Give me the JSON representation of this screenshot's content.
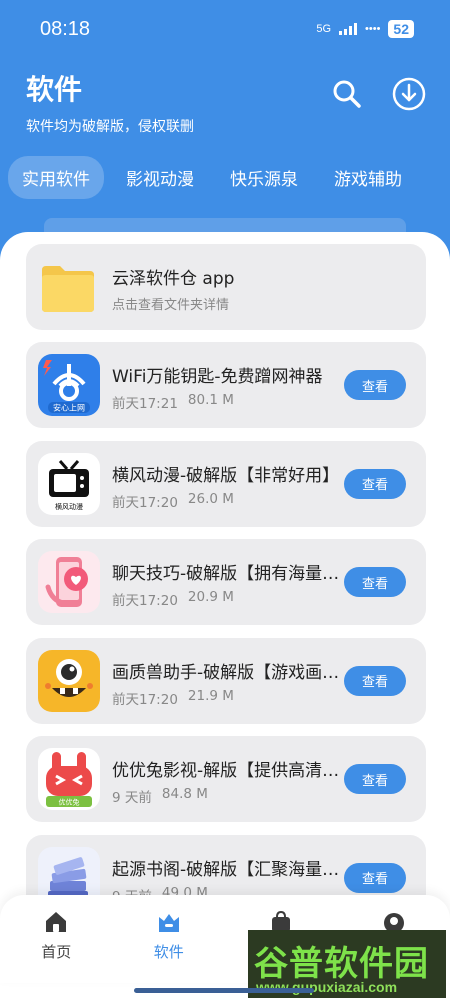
{
  "status": {
    "time": "08:18",
    "network": "5G",
    "battery": "52"
  },
  "header": {
    "title": "软件",
    "subtitle": "软件均为破解版，侵权联删"
  },
  "tabs": [
    {
      "label": "实用软件",
      "active": true
    },
    {
      "label": "影视动漫",
      "active": false
    },
    {
      "label": "快乐源泉",
      "active": false
    },
    {
      "label": "游戏辅助",
      "active": false
    }
  ],
  "folder": {
    "title": "云泽软件仓 app",
    "subtitle": "点击查看文件夹详情"
  },
  "apps": [
    {
      "title": "WiFi万能钥匙-免费蹭网神器",
      "time": "前天17:21",
      "size": "80.1 M",
      "button": "查看"
    },
    {
      "title": "横风动漫-破解版【非常好用】",
      "time": "前天17:20",
      "size": "26.0 M",
      "button": "查看"
    },
    {
      "title": "聊天技巧-破解版【拥有海量话术】",
      "time": "前天17:20",
      "size": "20.9 M",
      "button": "查看"
    },
    {
      "title": "画质兽助手-破解版【游戏画质】",
      "time": "前天17:20",
      "size": "21.9 M",
      "button": "查看"
    },
    {
      "title": "优优兔影视-解版【提供高清影视】",
      "time": "9 天前",
      "size": "84.8 M",
      "button": "查看"
    },
    {
      "title": "起源书阁-破解版【汇聚海量小说】",
      "time": "9 天前",
      "size": "49.0 M",
      "button": "查看"
    }
  ],
  "icon_texts": {
    "wifi": "安心上网",
    "tv": "横风动漫",
    "rabbit": "优优兔"
  },
  "nav": [
    {
      "label": "首页",
      "active": false
    },
    {
      "label": "软件",
      "active": true
    },
    {
      "label": "",
      "active": false
    },
    {
      "label": "",
      "active": false
    }
  ],
  "watermark": {
    "title": "谷普软件园",
    "url": "www.gupuxiazai.com"
  },
  "colors": {
    "primary": "#3f8ee6",
    "card": "#ececee"
  }
}
